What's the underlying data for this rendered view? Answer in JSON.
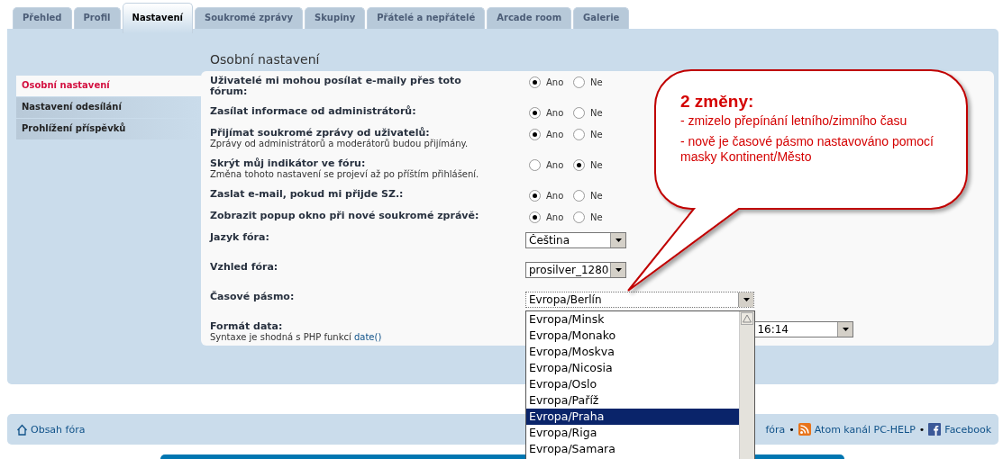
{
  "tabs": [
    {
      "label": "Přehled",
      "selected": false
    },
    {
      "label": "Profil",
      "selected": false
    },
    {
      "label": "Nastavení",
      "selected": true
    },
    {
      "label": "Soukromé zprávy",
      "selected": false
    },
    {
      "label": "Skupiny",
      "selected": false
    },
    {
      "label": "Přátelé a nepřátelé",
      "selected": false
    },
    {
      "label": "Arcade room",
      "selected": false
    },
    {
      "label": "Galerie",
      "selected": false
    }
  ],
  "sidebar": {
    "items": [
      {
        "label": "Osobní nastavení",
        "selected": true
      },
      {
        "label": "Nastavení odesílání",
        "selected": false
      },
      {
        "label": "Prohlížení příspěvků",
        "selected": false
      }
    ]
  },
  "section_title": "Osobní nastavení",
  "settings": [
    {
      "kind": "radio",
      "label": "Uživatelé mi mohou posílat e-maily přes toto fórum:",
      "options": [
        {
          "label": "Ano",
          "selected": true
        },
        {
          "label": "Ne",
          "selected": false
        }
      ]
    },
    {
      "kind": "radio",
      "label": "Zasílat informace od administrátorů:",
      "options": [
        {
          "label": "Ano",
          "selected": true
        },
        {
          "label": "Ne",
          "selected": false
        }
      ]
    },
    {
      "kind": "radio",
      "label": "Přijímat soukromé zprávy od uživatelů:",
      "hint": "Zprávy od administrátorů a moderátorů budou přijímány.",
      "options": [
        {
          "label": "Ano",
          "selected": true
        },
        {
          "label": "Ne",
          "selected": false
        }
      ]
    },
    {
      "kind": "radio",
      "label": "Skrýt můj indikátor ve fóru:",
      "hint": "Změna tohoto nastavení se projeví až po příštím přihlášení.",
      "options": [
        {
          "label": "Ano",
          "selected": false
        },
        {
          "label": "Ne",
          "selected": true
        }
      ]
    },
    {
      "kind": "radio",
      "label": "Zaslat e-mail, pokud mi přijde SZ.:",
      "options": [
        {
          "label": "Ano",
          "selected": true
        },
        {
          "label": "Ne",
          "selected": false
        }
      ]
    },
    {
      "kind": "radio",
      "label": "Zobrazit popup okno při nové soukromé zprávě:",
      "options": [
        {
          "label": "Ano",
          "selected": true
        },
        {
          "label": "Ne",
          "selected": false
        }
      ]
    },
    {
      "kind": "select",
      "label": "Jazyk fóra:",
      "value": "Čeština"
    },
    {
      "kind": "select",
      "label": "Vzhled fóra:",
      "value": "prosilver_1280"
    },
    {
      "kind": "select",
      "label": "Časové pásmo:",
      "value": "Evropa/Berlín",
      "open": true,
      "options": [
        {
          "label": "Evropa/Minsk",
          "selected": false
        },
        {
          "label": "Evropa/Monako",
          "selected": false
        },
        {
          "label": "Evropa/Moskva",
          "selected": false
        },
        {
          "label": "Evropa/Nicosia",
          "selected": false
        },
        {
          "label": "Evropa/Oslo",
          "selected": false
        },
        {
          "label": "Evropa/Paříž",
          "selected": false
        },
        {
          "label": "Evropa/Praha",
          "selected": true
        },
        {
          "label": "Evropa/Riga",
          "selected": false
        },
        {
          "label": "Evropa/Samara",
          "selected": false
        }
      ]
    },
    {
      "kind": "select",
      "label": "Formát data:",
      "hint": "Syntaxe je shodná s PHP funkcí",
      "hint_link": "date()",
      "value": "16:14"
    }
  ],
  "callout": {
    "title": "2 změny:",
    "lines": [
      "- zmizelo přepínání letního/zimního času",
      "- nově je časové pásmo nastavováno pomocí masky Kontinent/Město"
    ]
  },
  "footer": {
    "home_link": "Obsah fóra",
    "separator": "•",
    "links": [
      {
        "kind": "text",
        "label": "fóra"
      },
      {
        "kind": "feed",
        "label": "Atom kanál PC-HELP"
      },
      {
        "kind": "facebook",
        "label": "Facebook"
      }
    ]
  }
}
